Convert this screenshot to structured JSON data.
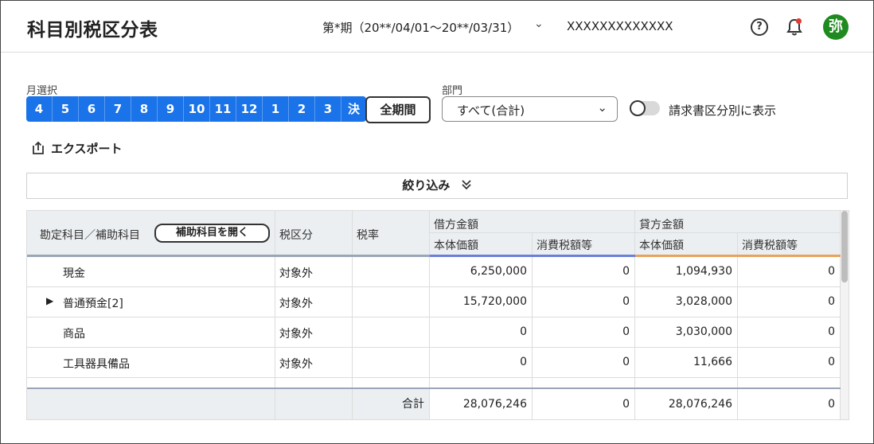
{
  "header": {
    "title": "科目別税区分表",
    "period": "第*期（20**/04/01〜20**/03/31）",
    "company": "XXXXXXXXXXXXX",
    "help_icon": "question-circle-icon",
    "bell_icon": "bell-icon",
    "avatar": "弥"
  },
  "controls": {
    "month_label": "月選択",
    "months": [
      "4",
      "5",
      "6",
      "7",
      "8",
      "9",
      "10",
      "11",
      "12",
      "1",
      "2",
      "3",
      "決"
    ],
    "all_period": "全期間",
    "dept_label": "部門",
    "dept_value": "すべて(合計)",
    "toggle_label": "請求書区分別に表示",
    "export": "エクスポート",
    "filter": "絞り込み"
  },
  "colors": {
    "accent": "#1a73e8",
    "debit_underline": "#6b7fd7",
    "credit_underline": "#e8a25c",
    "avatar_bg": "#1f8a1f"
  },
  "table": {
    "headers": {
      "account": "勘定科目／補助科目",
      "open_sub": "補助科目を開く",
      "tax_class": "税区分",
      "tax_rate": "税率",
      "debit": "借方金額",
      "credit": "貸方金額",
      "body_price": "本体価額",
      "consumption_tax": "消費税額等"
    },
    "rows": [
      {
        "account": "現金",
        "expand": "",
        "tax_class": "対象外",
        "rate": "",
        "d_body": "6,250,000",
        "d_tax": "0",
        "c_body": "1,094,930",
        "c_tax": "0"
      },
      {
        "account": "普通預金[2]",
        "expand": "▶",
        "tax_class": "対象外",
        "rate": "",
        "d_body": "15,720,000",
        "d_tax": "0",
        "c_body": "3,028,000",
        "c_tax": "0"
      },
      {
        "account": "商品",
        "expand": "",
        "tax_class": "対象外",
        "rate": "",
        "d_body": "0",
        "d_tax": "0",
        "c_body": "3,030,000",
        "c_tax": "0"
      },
      {
        "account": "工具器具備品",
        "expand": "",
        "tax_class": "対象外",
        "rate": "",
        "d_body": "0",
        "d_tax": "0",
        "c_body": "11,666",
        "c_tax": "0"
      }
    ],
    "total": {
      "label": "合計",
      "d_body": "28,076,246",
      "d_tax": "0",
      "c_body": "28,076,246",
      "c_tax": "0"
    }
  }
}
